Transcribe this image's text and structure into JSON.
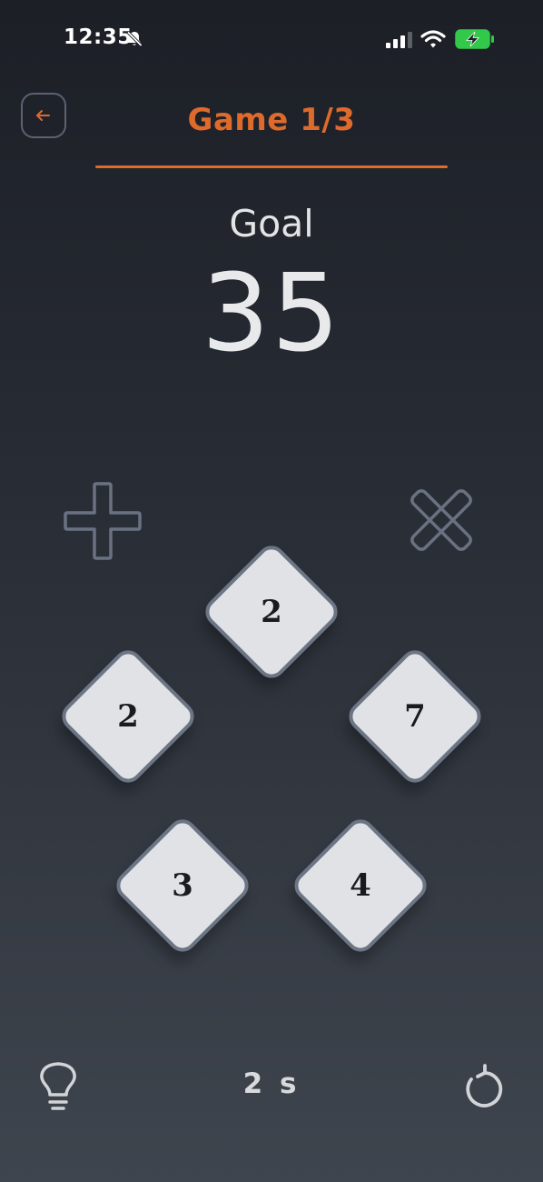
{
  "status_bar": {
    "time": "12:35",
    "icons": [
      "bell-muted-icon",
      "signal-icon",
      "wifi-icon",
      "battery-charging-icon"
    ]
  },
  "header": {
    "title": "Game 1/3",
    "back_icon": "arrow-left-icon"
  },
  "goal": {
    "label": "Goal",
    "value": "35"
  },
  "operators": [
    {
      "name": "plus",
      "icon": "plus-icon"
    },
    {
      "name": "multiply",
      "icon": "multiply-icon"
    }
  ],
  "tiles": [
    {
      "value": "2"
    },
    {
      "value": "2"
    },
    {
      "value": "7"
    },
    {
      "value": "3"
    },
    {
      "value": "4"
    }
  ],
  "footer": {
    "hint_icon": "lightbulb-icon",
    "timer": "2 s",
    "reset_icon": "restart-icon"
  },
  "colors": {
    "accent": "#de6a2c",
    "tile_fill": "#e1e2e6",
    "tile_border": "#6c7585",
    "background_top": "#1c1f26",
    "background_bottom": "#3f454e"
  }
}
